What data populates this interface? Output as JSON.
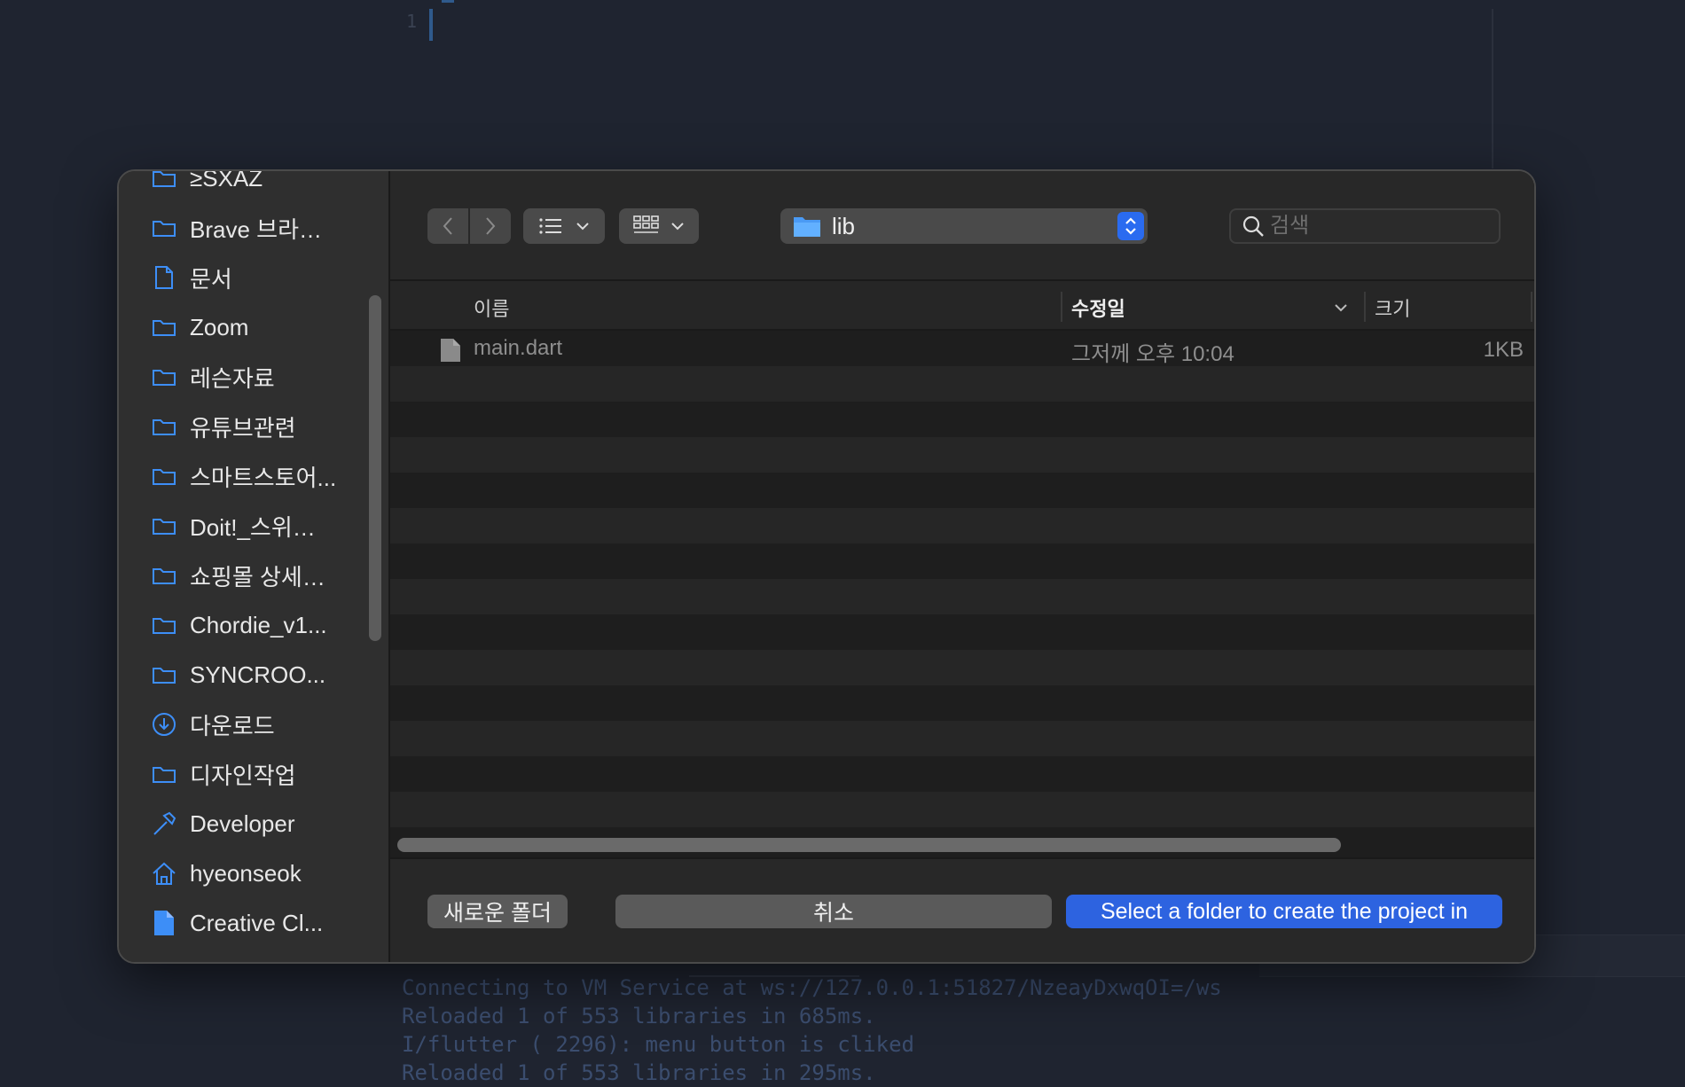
{
  "background": {
    "editor_line_number": "1",
    "console_lines": [
      "Connecting to VM Service at ws://127.0.0.1:51827/NzeayDxwqOI=/ws",
      "Reloaded 1 of 553 libraries in 685ms.",
      "I/flutter ( 2296): menu button is cliked",
      "Reloaded 1 of 553 libraries in 295ms."
    ]
  },
  "sidebar": {
    "items": [
      {
        "label": "≥SXAZ",
        "icon": "folder-icon"
      },
      {
        "label": "Brave 브라…",
        "icon": "folder-icon"
      },
      {
        "label": "문서",
        "icon": "document-icon"
      },
      {
        "label": "Zoom",
        "icon": "folder-icon"
      },
      {
        "label": "레슨자료",
        "icon": "folder-icon"
      },
      {
        "label": "유튜브관련",
        "icon": "folder-icon"
      },
      {
        "label": "스마트스토어...",
        "icon": "folder-icon"
      },
      {
        "label": "Doit!_스위…",
        "icon": "folder-icon"
      },
      {
        "label": "쇼핑몰 상세…",
        "icon": "folder-icon"
      },
      {
        "label": "Chordie_v1...",
        "icon": "folder-icon"
      },
      {
        "label": "SYNCROO...",
        "icon": "folder-icon"
      },
      {
        "label": "다운로드",
        "icon": "download-icon"
      },
      {
        "label": "디자인작업",
        "icon": "folder-icon"
      },
      {
        "label": "Developer",
        "icon": "hammer-icon"
      },
      {
        "label": "hyeonseok",
        "icon": "home-icon"
      },
      {
        "label": "Creative Cl...",
        "icon": "file-icon"
      }
    ]
  },
  "toolbar": {
    "path_label": "lib",
    "search_placeholder": "검색"
  },
  "columns": {
    "name": "이름",
    "modified": "수정일",
    "size": "크기"
  },
  "files": [
    {
      "name": "main.dart",
      "modified": "그저께 오후 10:04",
      "size": "1KB"
    }
  ],
  "footer": {
    "new_folder": "새로운 폴더",
    "cancel": "취소",
    "confirm": "Select a folder to create the project in"
  },
  "colors": {
    "accent": "#2d63e0",
    "folder_icon": "#3d8ef7"
  }
}
